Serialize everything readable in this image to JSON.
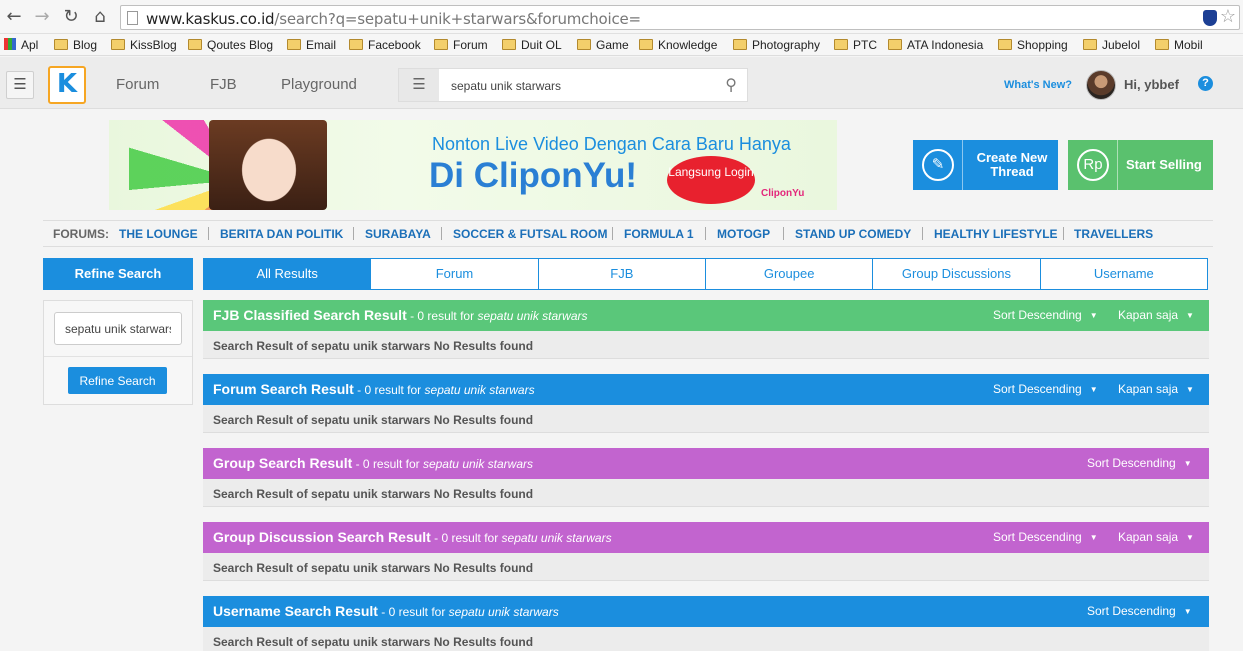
{
  "browser": {
    "url_host": "www.kaskus.co.id",
    "url_path": "/search?q=sepatu+unik+starwars&forumchoice=",
    "bookmarks": [
      "Apl",
      "Blog",
      "KissBlog",
      "Qoutes Blog",
      "Email",
      "Facebook",
      "Forum",
      "Duit OL",
      "Game",
      "Knowledge",
      "Photography",
      "PTC",
      "ATA Indonesia",
      "Shopping",
      "Jubelol",
      "Mobil"
    ]
  },
  "header": {
    "logo_letter": "K",
    "nav": [
      "Forum",
      "FJB",
      "Playground"
    ],
    "search_value": "sepatu unik starwars",
    "whats_new": "What's New?",
    "greeting": "Hi, ybbef",
    "help": "?"
  },
  "banner": {
    "line1": "Nonton Live Video Dengan Cara Baru Hanya",
    "line2": "Di CliponYu!",
    "cta": "Langsung Login",
    "brand": "CliponYu"
  },
  "actions": {
    "create_thread": "Create New Thread",
    "start_selling": "Start Selling",
    "rp_icon": "Rp"
  },
  "forums": {
    "label": "FORUMS:",
    "items": [
      "THE LOUNGE",
      "BERITA DAN POLITIK",
      "SURABAYA",
      "SOCCER & FUTSAL ROOM",
      "FORMULA 1",
      "MOTOGP",
      "STAND UP COMEDY",
      "HEALTHY LIFESTYLE",
      "TRAVELLERS"
    ]
  },
  "sidebar": {
    "title": "Refine Search",
    "input_value": "sepatu unik starwars",
    "button": "Refine Search"
  },
  "tabs": [
    "All Results",
    "Forum",
    "FJB",
    "Groupee",
    "Group Discussions",
    "Username"
  ],
  "sections": [
    {
      "title": "FJB Classified Search Result",
      "count_text": " - 0 result for ",
      "query": "sepatu unik starwars",
      "sort": "Sort Descending",
      "time": "Kapan saja",
      "body": "Search Result of sepatu unik starwars No Results found",
      "color": "#5ac77a"
    },
    {
      "title": "Forum Search Result",
      "count_text": " - 0 result for ",
      "query": "sepatu unik starwars",
      "sort": "Sort Descending",
      "time": "Kapan saja",
      "body": "Search Result of sepatu unik starwars No Results found",
      "color": "#1b8ede"
    },
    {
      "title": "Group Search Result",
      "count_text": " - 0 result for ",
      "query": "sepatu unik starwars",
      "sort": "Sort Descending",
      "time": "",
      "body": "Search Result of sepatu unik starwars No Results found",
      "color": "#c264cf"
    },
    {
      "title": "Group Discussion Search Result",
      "count_text": " - 0 result for ",
      "query": "sepatu unik starwars",
      "sort": "Sort Descending",
      "time": "Kapan saja",
      "body": "Search Result of sepatu unik starwars No Results found",
      "color": "#c264cf"
    },
    {
      "title": "Username Search Result",
      "count_text": " - 0 result for ",
      "query": "sepatu unik starwars",
      "sort": "Sort Descending",
      "time": "",
      "body": "Search Result of sepatu unik starwars No Results found",
      "color": "#1b8ede"
    }
  ]
}
